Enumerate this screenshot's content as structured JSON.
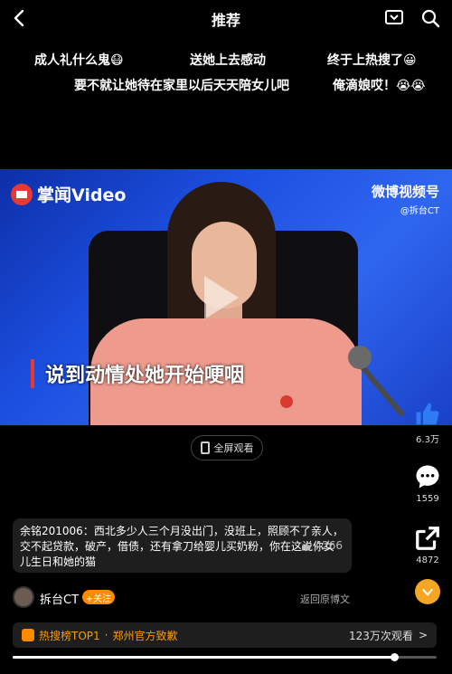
{
  "header": {
    "title": "推荐"
  },
  "danmaku": [
    {
      "text": "成人礼什么鬼😷"
    },
    {
      "text": "送她上去感动"
    },
    {
      "text": "终于上热搜了😀"
    },
    {
      "text": "要不就让她待在家里以后天天陪女儿吧"
    },
    {
      "text": "俺滴娘哎！😭😭"
    }
  ],
  "video": {
    "source_logo": "掌闻Video",
    "watermark": "微博视频号",
    "watermark_handle": "@拆台CT",
    "caption": "说到动情处她开始哽咽",
    "fullscreen_label": "全屏观看"
  },
  "actions": {
    "likes": "6.3万",
    "comments": "1559",
    "shares": "4872"
  },
  "top_comment": {
    "user": "余铭201006：",
    "text": "西北多少人三个月没出门，没班上，照顾不了亲人，交不起贷款，破产，借债，还有拿刀给婴儿买奶粉，你在这说你女儿生日和她的猫",
    "likes": "4266"
  },
  "account": {
    "name": "拆台CT",
    "follow_label": "+关注",
    "origin_label": "返回原博文"
  },
  "hot": {
    "label": "热搜榜TOP1",
    "separator": "·",
    "topic": "郑州官方致歉",
    "views": "123万次观看",
    "chevron": ">"
  },
  "playback": {
    "progress": 0.9
  },
  "colors": {
    "accent": "#ff8a00",
    "like_blue": "#2f7bf5"
  }
}
